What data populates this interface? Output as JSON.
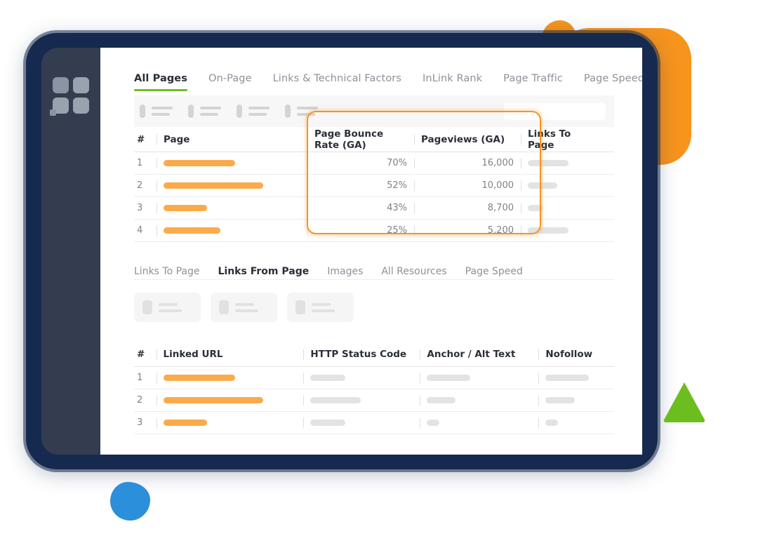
{
  "app": {
    "logo_name": "grid-logo"
  },
  "primary_tabs": [
    {
      "label": "All Pages",
      "active": true
    },
    {
      "label": "On-Page",
      "active": false
    },
    {
      "label": "Links & Technical Factors",
      "active": false
    },
    {
      "label": "InLink Rank",
      "active": false
    },
    {
      "label": "Page Traffic",
      "active": false
    },
    {
      "label": "Page Speed",
      "active": false
    }
  ],
  "filter_bar": {
    "chip_count": 4,
    "search_placeholder": ""
  },
  "main_table": {
    "headers": {
      "num": "#",
      "page": "Page",
      "bounce": "Page Bounce Rate (GA)",
      "pageviews": "Pageviews (GA)",
      "links_to_page": "Links To Page"
    },
    "rows": [
      {
        "num": "1",
        "page_bar_width": 102,
        "bounce": "70%",
        "pageviews": "16,000",
        "links_bar_width": 58
      },
      {
        "num": "2",
        "page_bar_width": 142,
        "bounce": "52%",
        "pageviews": "10,000",
        "links_bar_width": 42
      },
      {
        "num": "3",
        "page_bar_width": 62,
        "bounce": "43%",
        "pageviews": "8,700",
        "links_bar_width": 22
      },
      {
        "num": "4",
        "page_bar_width": 81,
        "bounce": "25%",
        "pageviews": "5,200",
        "links_bar_width": 58
      }
    ]
  },
  "highlight": {
    "name": "ga-metrics-highlight",
    "color": "#f7941e"
  },
  "secondary_tabs": [
    {
      "label": "Links To Page",
      "active": false
    },
    {
      "label": "Links From Page",
      "active": true
    },
    {
      "label": "Images",
      "active": false
    },
    {
      "label": "All Resources",
      "active": false
    },
    {
      "label": "Page Speed",
      "active": false
    }
  ],
  "card_row": {
    "card_count": 3
  },
  "bottom_table": {
    "headers": {
      "num": "#",
      "url": "Linked URL",
      "http": "HTTP Status Code",
      "anchor": "Anchor / Alt Text",
      "nofollow": "Nofollow"
    },
    "rows": [
      {
        "num": "1",
        "url_bar_width": 102,
        "http_bar_width": 50,
        "anchor_bar_width": 62,
        "nofollow_bar_width": 62
      },
      {
        "num": "2",
        "url_bar_width": 142,
        "http_bar_width": 72,
        "anchor_bar_width": 41,
        "nofollow_bar_width": 42
      },
      {
        "num": "3",
        "url_bar_width": 62,
        "http_bar_width": 50,
        "anchor_bar_width": 18,
        "nofollow_bar_width": 18
      }
    ]
  },
  "decorations": {
    "orange": "#f7941e",
    "green": "#6cbe1e",
    "blue": "#2b8fdb",
    "frame_navy": "#152a4e",
    "sidebar_slate": "#343d4f",
    "accent_bar": "#fbaa4b"
  }
}
